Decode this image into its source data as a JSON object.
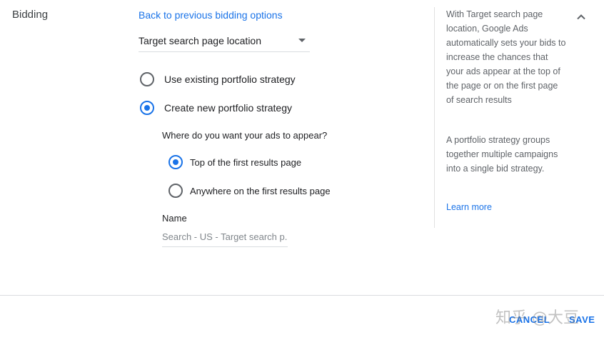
{
  "bidding": {
    "section_label": "Bidding",
    "back_link": "Back to previous bidding options",
    "strategy_select": {
      "selected": "Target search page location"
    },
    "strategy_options": [
      {
        "label": "Use existing portfolio strategy",
        "checked": false
      },
      {
        "label": "Create new portfolio strategy",
        "checked": true
      }
    ],
    "placement_question": "Where do you want your ads to appear?",
    "placement_options": [
      {
        "label": "Top of the first results page",
        "checked": true
      },
      {
        "label": "Anywhere on the first results page",
        "checked": false
      }
    ],
    "name_field": {
      "label": "Name",
      "placeholder": "Search - US - Target search p...",
      "value": ""
    }
  },
  "help_panel": {
    "paragraph_1": "With Target search page location, Google Ads automatically sets your bids to increase the chances that your ads appear at the top of the page or on the first page of search results",
    "paragraph_2": "A portfolio strategy groups together multiple campaigns into a single bid strategy.",
    "learn_more": "Learn more",
    "collapse_icon": "chevron-up-icon"
  },
  "footer": {
    "cancel_label": "CANCEL",
    "save_label": "SAVE"
  },
  "watermark": "知乎 @大豆",
  "colors": {
    "accent": "#1a73e8",
    "text_primary": "#202124",
    "text_secondary": "#5f6368",
    "divider": "#dadce0"
  }
}
